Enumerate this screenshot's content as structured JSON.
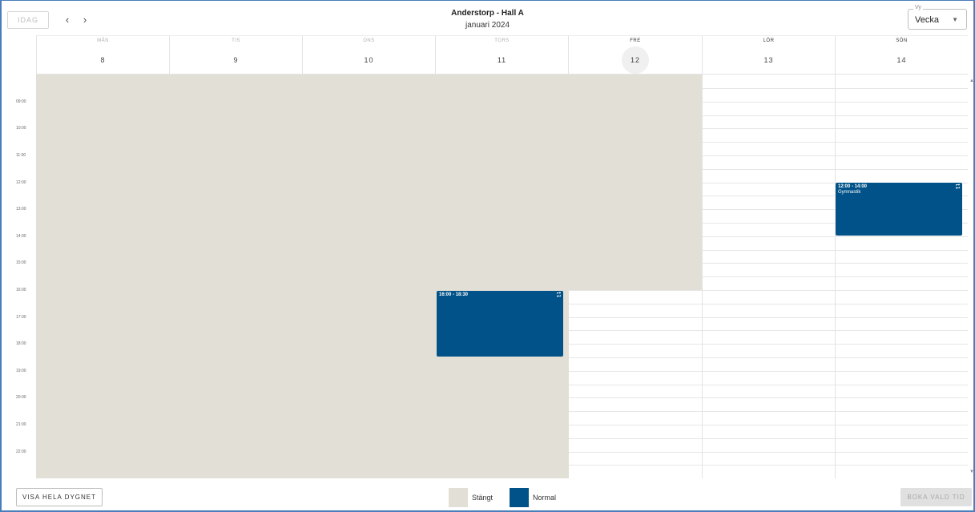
{
  "toolbar": {
    "today_label": "IDAG",
    "prev_icon": "chevron-left-icon",
    "next_icon": "chevron-right-icon",
    "title": "Anderstorp - Hall A",
    "subtitle": "januari 2024",
    "view_legend": "Vy",
    "view_value": "Vecka"
  },
  "days": [
    {
      "name": "MÅN",
      "num": "8"
    },
    {
      "name": "TIS",
      "num": "9"
    },
    {
      "name": "ONS",
      "num": "10"
    },
    {
      "name": "TORS",
      "num": "11"
    },
    {
      "name": "FRE",
      "num": "12"
    },
    {
      "name": "LÖR",
      "num": "13"
    },
    {
      "name": "SÖN",
      "num": "14"
    }
  ],
  "times": [
    "09:00",
    "10:00",
    "11:00",
    "12:00",
    "13:00",
    "14:00",
    "15:00",
    "16:00",
    "17:00",
    "18:00",
    "19:00",
    "20:00",
    "21:00",
    "22:00"
  ],
  "events": [
    {
      "time": "16:00 - 18:30",
      "title": "",
      "day": "TORS",
      "icon": "repeat-icon"
    },
    {
      "time": "12:00 - 14:00",
      "title": "Gymnastik",
      "day": "SÖN",
      "icon": "repeat-icon"
    }
  ],
  "footer": {
    "show_all_label": "VISA HELA DYGNET",
    "legend": [
      {
        "label": "Stängt",
        "color": "#e2e0d6"
      },
      {
        "label": "Normal",
        "color": "#005288"
      }
    ],
    "book_label": "BOKA VALD TID"
  },
  "colors": {
    "closed": "#e2e0d6",
    "event": "#005288",
    "frame": "#4a7ebb"
  }
}
